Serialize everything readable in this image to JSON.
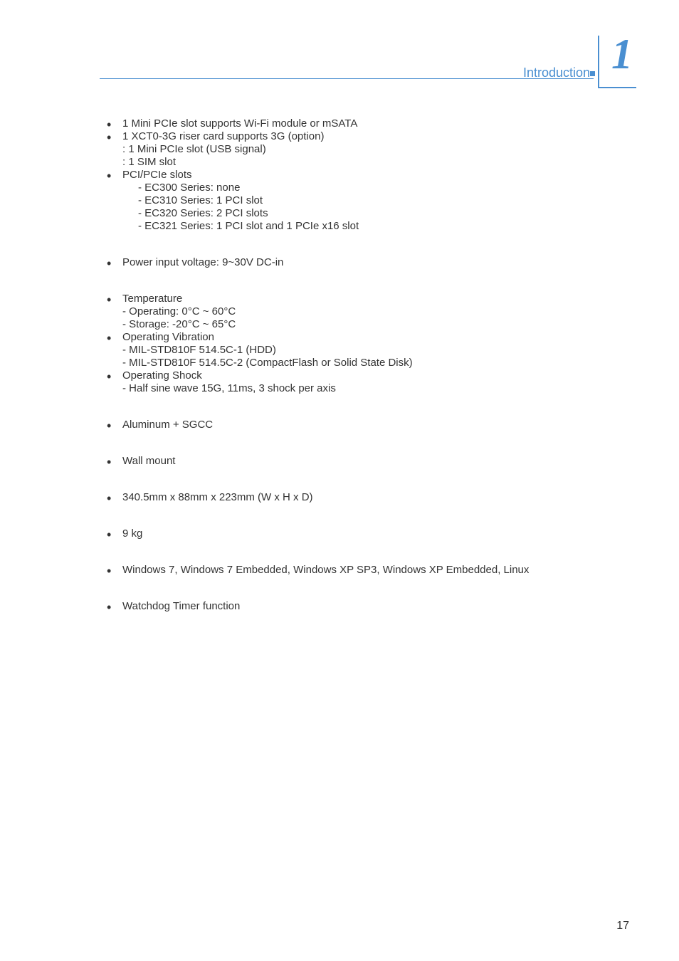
{
  "header": {
    "label": "Introduction",
    "chapter_number": "1"
  },
  "sections": {
    "expansion": {
      "item1": "1 Mini PCIe slot supports Wi-Fi module or mSATA",
      "item2": "1 XCT0-3G riser card supports 3G (option)",
      "item2a": ": 1 Mini PCIe slot (USB signal)",
      "item2b": ": 1 SIM slot",
      "item3": "PCI/PCIe slots",
      "item3a": "- EC300 Series: none",
      "item3b": "- EC310 Series: 1 PCI slot",
      "item3c": "- EC320 Series: 2 PCI slots",
      "item3d": "- EC321 Series: 1 PCI slot and 1 PCIe x16 slot"
    },
    "power": {
      "item1": "Power input voltage: 9~30V DC-in"
    },
    "environment": {
      "item1": "Temperature",
      "item1a": "-  Operating: 0°C ~ 60°C",
      "item1b": "-  Storage: -20°C ~ 65°C",
      "item2": "Operating Vibration",
      "item2a": "-  MIL-STD810F 514.5C-1 (HDD)",
      "item2b": "-  MIL-STD810F 514.5C-2 (CompactFlash or Solid State Disk)",
      "item3": "Operating Shock",
      "item3a": "-  Half sine wave 15G, 11ms, 3 shock per axis"
    },
    "construction": {
      "item1": "Aluminum + SGCC"
    },
    "mounting": {
      "item1": "Wall mount"
    },
    "dimensions": {
      "item1": "340.5mm x 88mm x 223mm (W x H x D)"
    },
    "weight": {
      "item1": "9 kg"
    },
    "os": {
      "item1": "Windows 7, Windows 7 Embedded, Windows XP SP3, Windows XP Embedded, Linux"
    },
    "features": {
      "item1": "Watchdog Timer function"
    }
  },
  "page_number": "17"
}
